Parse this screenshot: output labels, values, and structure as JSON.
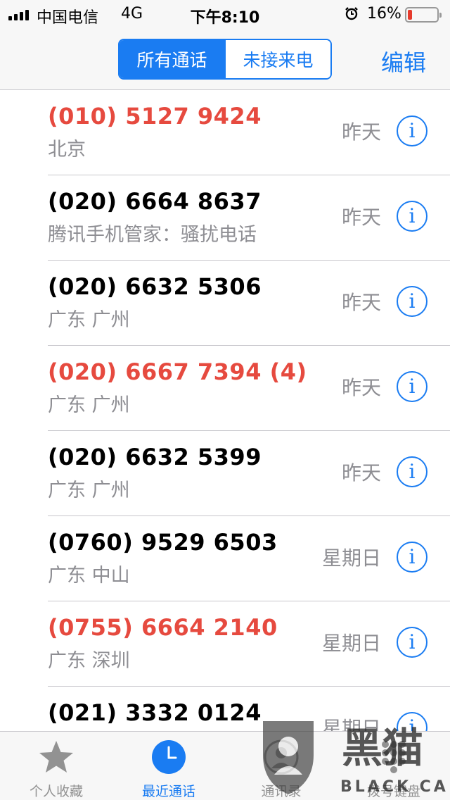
{
  "status_bar": {
    "carrier": "中国电信",
    "network": "4G",
    "time": "下午8:10",
    "battery_percent": "16%",
    "battery_level": 0.16,
    "battery_color": "#e63a2c"
  },
  "nav": {
    "segments": [
      "所有通话",
      "未接来电"
    ],
    "active_segment": 0,
    "edit_label": "编辑"
  },
  "accent_color": "#1a7cf2",
  "missed_color": "#e64a3f",
  "calls": [
    {
      "number": "(010) 5127 9424",
      "location": "北京",
      "date": "昨天",
      "missed": true
    },
    {
      "number": "(020) 6664 8637",
      "location": "腾讯手机管家：骚扰电话",
      "date": "昨天",
      "missed": false
    },
    {
      "number": "(020) 6632 5306",
      "location": "广东 广州",
      "date": "昨天",
      "missed": false
    },
    {
      "number": "(020) 6667 7394 (4)",
      "location": "广东 广州",
      "date": "昨天",
      "missed": true
    },
    {
      "number": "(020) 6632 5399",
      "location": "广东 广州",
      "date": "昨天",
      "missed": false
    },
    {
      "number": "(0760) 9529 6503",
      "location": "广东 中山",
      "date": "星期日",
      "missed": false
    },
    {
      "number": "(0755) 6664 2140",
      "location": "广东 深圳",
      "date": "星期日",
      "missed": true
    },
    {
      "number": "(021) 3332 0124",
      "location": "",
      "date": "星期日",
      "missed": false
    }
  ],
  "info_glyph": "i",
  "tabs": [
    {
      "label": "个人收藏",
      "icon": "star-icon",
      "active": false
    },
    {
      "label": "最近通话",
      "icon": "clock-icon",
      "active": true
    },
    {
      "label": "通讯录",
      "icon": "contacts-icon",
      "active": false
    },
    {
      "label": "拨号键盘",
      "icon": "keypad-icon",
      "active": false
    }
  ],
  "watermark": {
    "text_cn": "黑猫",
    "text_en": "BLACK CAT"
  }
}
